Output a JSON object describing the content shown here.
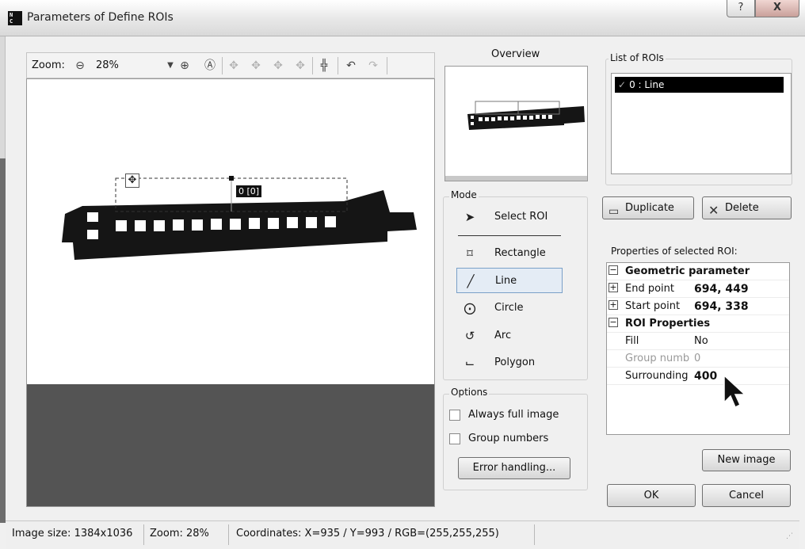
{
  "window": {
    "title": "Parameters of Define ROIs",
    "app_icon_text": "N\nC",
    "help_label": "?",
    "close_label": "X"
  },
  "toolbar": {
    "zoom_label": "Zoom:",
    "zoom_value": "28%"
  },
  "canvas": {
    "roi_label": "0 [0]"
  },
  "overview": {
    "label": "Overview"
  },
  "roi_list": {
    "title": "List of ROIs",
    "items": [
      {
        "label": "0 : Line",
        "selected": true
      }
    ]
  },
  "buttons": {
    "duplicate": "Duplicate",
    "delete": "Delete",
    "new_image": "New image",
    "ok": "OK",
    "cancel": "Cancel",
    "error_handling": "Error handling..."
  },
  "mode": {
    "title": "Mode",
    "items": [
      {
        "label": "Select ROI",
        "icon": "arrow-pointer-icon"
      },
      {
        "label": "Rectangle",
        "icon": "rectangle-icon"
      },
      {
        "label": "Line",
        "icon": "line-icon",
        "selected": true
      },
      {
        "label": "Circle",
        "icon": "circle-icon"
      },
      {
        "label": "Arc",
        "icon": "arc-icon"
      },
      {
        "label": "Polygon",
        "icon": "polygon-icon"
      }
    ]
  },
  "options": {
    "title": "Options",
    "always_full_image": "Always full image",
    "group_numbers": "Group numbers",
    "always_full_image_checked": false,
    "group_numbers_checked": false
  },
  "properties": {
    "label": "Properties of selected ROI:",
    "geometric_header": "Geometric parameter",
    "end_point_name": "End point",
    "end_point_value": "694, 449",
    "start_point_name": "Start point",
    "start_point_value": "694, 338",
    "roi_header": "ROI Properties",
    "fill_name": "Fill",
    "fill_value": "No",
    "group_name": "Group numb",
    "group_value": "0",
    "surrounding_name": "Surrounding",
    "surrounding_value": "400"
  },
  "status": {
    "image_size": "Image size: 1384x1036",
    "zoom": "Zoom:  28%",
    "coordinates": "Coordinates:  X=935 / Y=993 / RGB=(255,255,255)"
  }
}
